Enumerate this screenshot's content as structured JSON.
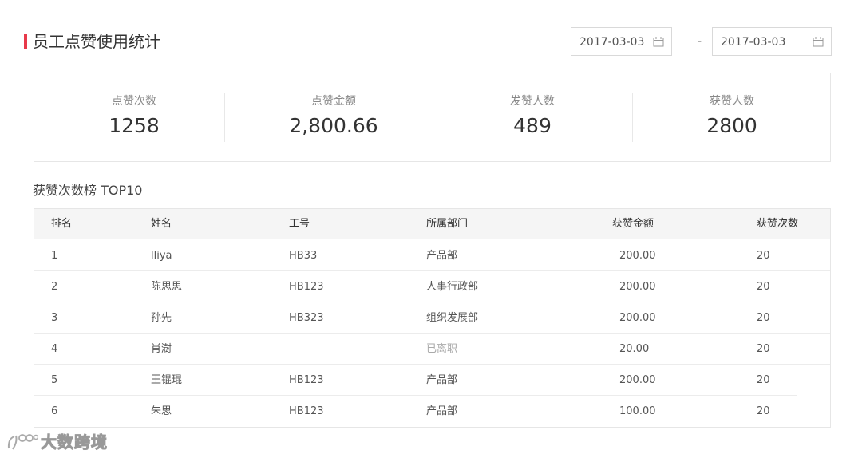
{
  "header": {
    "title": "员工点赞使用统计",
    "accent_color": "#e8394a",
    "date_start": "2017-03-03",
    "date_separator": "-",
    "date_end": "2017-03-03",
    "date_icon": "calendar-icon"
  },
  "stats": [
    {
      "label": "点赞次数",
      "value": "1258"
    },
    {
      "label": "点赞金额",
      "value": "2,800.66"
    },
    {
      "label": "发赞人数",
      "value": "489"
    },
    {
      "label": "获赞人数",
      "value": "2800"
    }
  ],
  "ranking": {
    "title": "获赞次数榜 TOP10",
    "columns": [
      "排名",
      "姓名",
      "工号",
      "所属部门",
      "获赞金额",
      "获赞次数"
    ],
    "rows": [
      [
        "1",
        "lliya",
        "HB33",
        "产品部",
        "200.00",
        "20"
      ],
      [
        "2",
        "陈思思",
        "HB123",
        "人事行政部",
        "200.00",
        "20"
      ],
      [
        "3",
        "孙先",
        "HB323",
        "组织发展部",
        "200.00",
        "20"
      ],
      [
        "4",
        "肖澍",
        "—",
        "已离职",
        "20.00",
        "20"
      ],
      [
        "5",
        "王锟琨",
        "HB123",
        "产品部",
        "200.00",
        "20"
      ],
      [
        "6",
        "朱思",
        "HB123",
        "产品部",
        "100.00",
        "20"
      ]
    ]
  },
  "watermark": {
    "text": "大数跨境",
    "icon": "logo-icon"
  }
}
